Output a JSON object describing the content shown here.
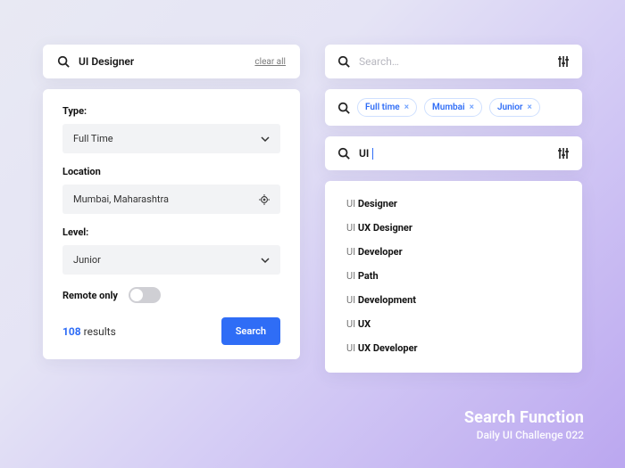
{
  "left": {
    "query": "UI Designer",
    "clear_label": "clear all",
    "type_label": "Type:",
    "type_value": "Full Time",
    "location_label": "Location",
    "location_value": "Mumbai, Maharashtra",
    "level_label": "Level:",
    "level_value": "Junior",
    "remote_label": "Remote only",
    "results_count": "108",
    "results_word": "results",
    "search_button": "Search"
  },
  "right": {
    "placeholder": "Search…",
    "chips": [
      "Full time",
      "Mumbai",
      "Junior"
    ],
    "typed_prefix": "UI",
    "suggestions": [
      {
        "match": "UI",
        "rest": " Designer"
      },
      {
        "match": "UI",
        "rest": " UX Designer"
      },
      {
        "match": "UI",
        "rest": " Developer"
      },
      {
        "match": "UI",
        "rest": " Path"
      },
      {
        "match": "UI",
        "rest": " Development"
      },
      {
        "match": "UI",
        "rest": " UX"
      },
      {
        "match": "UI",
        "rest": " UX Developer"
      }
    ]
  },
  "credit": {
    "title": "Search Function",
    "subtitle": "Daily UI Challenge 022"
  }
}
